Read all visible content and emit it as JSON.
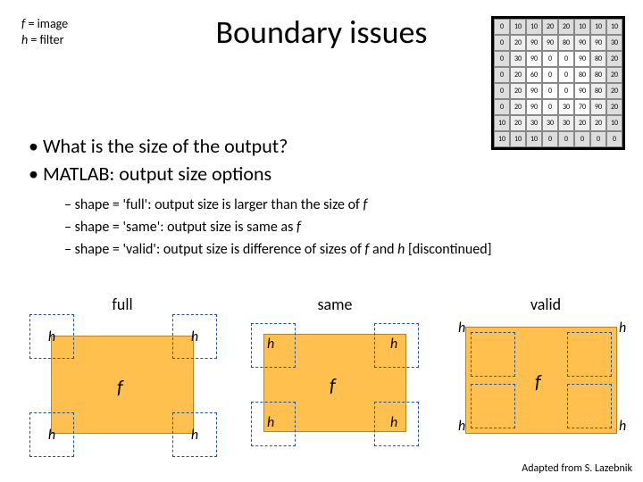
{
  "legend": {
    "line1_sym": "f",
    "line1_rest": " = image",
    "line2_sym": "h",
    "line2_rest": " = filter"
  },
  "title": "Boundary issues",
  "bullets": {
    "b1": "What is the size of the output?",
    "b2": "MATLAB: output size options"
  },
  "sub": {
    "s1a": "shape = 'full': output size is larger than the size of ",
    "s1b": "f",
    "s2a": "shape = 'same': output size is same as ",
    "s2b": "f",
    "s3a": "shape = 'valid': output size is difference of sizes of ",
    "s3b": "f",
    "s3c": " and ",
    "s3d": "h",
    "s3e": " [discontinued]"
  },
  "panels": {
    "p1": "full",
    "p2": "same",
    "p3": "valid"
  },
  "labels": {
    "h": "h",
    "f": "f"
  },
  "credit": "Adapted from S. Lazebnik",
  "grid": [
    [
      0,
      10,
      10,
      20,
      20,
      10,
      10,
      10
    ],
    [
      0,
      20,
      90,
      90,
      80,
      90,
      90,
      30
    ],
    [
      0,
      30,
      90,
      0,
      0,
      90,
      80,
      20
    ],
    [
      0,
      20,
      60,
      0,
      0,
      80,
      80,
      20
    ],
    [
      0,
      20,
      90,
      0,
      0,
      90,
      80,
      20
    ],
    [
      0,
      20,
      90,
      0,
      30,
      70,
      90,
      20
    ],
    [
      10,
      20,
      30,
      30,
      30,
      20,
      20,
      10
    ],
    [
      10,
      10,
      10,
      0,
      0,
      0,
      0,
      0
    ]
  ]
}
